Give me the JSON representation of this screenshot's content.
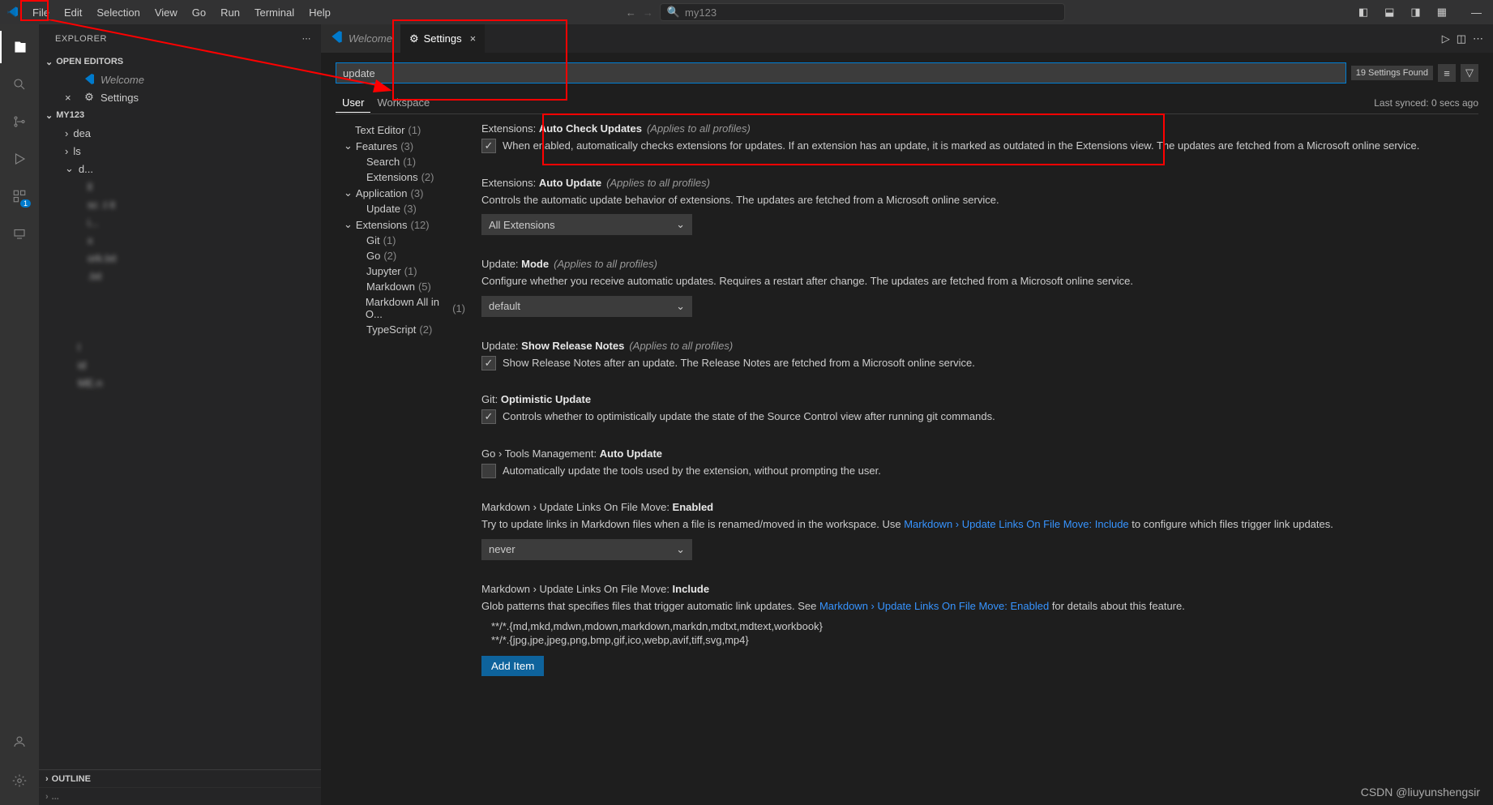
{
  "titlebar": {
    "menu": [
      "File",
      "Edit",
      "Selection",
      "View",
      "Go",
      "Run",
      "Terminal",
      "Help"
    ],
    "search_placeholder": "my123"
  },
  "sidebar": {
    "title": "EXPLORER",
    "open_editors_label": "OPEN EDITORS",
    "open_editors": [
      {
        "label": "Welcome",
        "icon": "vs"
      },
      {
        "label": "Settings",
        "icon": "settings",
        "close": true
      }
    ],
    "project_label": "MY123",
    "tree": [
      {
        "label": "dea",
        "type": "folder",
        "indent": 1
      },
      {
        "label": "ls",
        "type": "folder",
        "indent": 1
      },
      {
        "label": "d...",
        "type": "folder",
        "indent": 1,
        "open": true
      },
      {
        "label": "ll",
        "type": "file",
        "indent": 2,
        "blur": true
      },
      {
        "label": "sc    .t   it",
        "type": "file",
        "indent": 2,
        "blur": true
      },
      {
        "label": "i...",
        "type": "file",
        "indent": 2,
        "blur": true
      },
      {
        "label": "x",
        "type": "file",
        "indent": 2,
        "blur": true
      },
      {
        "label": "ork.txt",
        "type": "file",
        "indent": 2,
        "blur": true
      },
      {
        "label": ".txt",
        "type": "file",
        "indent": 2,
        "blur": true
      },
      {
        "label": "",
        "type": "file",
        "indent": 1,
        "blur": true
      },
      {
        "label": "",
        "type": "file",
        "indent": 1,
        "blur": true
      },
      {
        "label": "",
        "type": "file",
        "indent": 1,
        "blur": true
      },
      {
        "label": "l",
        "type": "file",
        "indent": 1,
        "blur": true
      },
      {
        "label": "id",
        "type": "file",
        "indent": 1,
        "blur": true
      },
      {
        "label": "ME.n",
        "type": "file",
        "indent": 1,
        "blur": true
      }
    ],
    "outline_label": "OUTLINE"
  },
  "tabs": {
    "items": [
      {
        "label": "Welcome",
        "icon": "vs",
        "active": false
      },
      {
        "label": "Settings",
        "icon": "settings",
        "active": true
      }
    ]
  },
  "settings": {
    "search_value": "update",
    "found_text": "19 Settings Found",
    "scope": {
      "user": "User",
      "workspace": "Workspace"
    },
    "sync_text": "Last synced: 0 secs ago",
    "tree": [
      {
        "label": "Text Editor",
        "count": "(1)",
        "level": 0
      },
      {
        "label": "Features",
        "count": "(3)",
        "level": 0,
        "expand": true
      },
      {
        "label": "Search",
        "count": "(1)",
        "level": 1
      },
      {
        "label": "Extensions",
        "count": "(2)",
        "level": 1
      },
      {
        "label": "Application",
        "count": "(3)",
        "level": 0,
        "expand": true
      },
      {
        "label": "Update",
        "count": "(3)",
        "level": 1
      },
      {
        "label": "Extensions",
        "count": "(12)",
        "level": 0,
        "expand": true
      },
      {
        "label": "Git",
        "count": "(1)",
        "level": 1
      },
      {
        "label": "Go",
        "count": "(2)",
        "level": 1
      },
      {
        "label": "Jupyter",
        "count": "(1)",
        "level": 1
      },
      {
        "label": "Markdown",
        "count": "(5)",
        "level": 1
      },
      {
        "label": "Markdown All in O...",
        "count": "(1)",
        "level": 1
      },
      {
        "label": "TypeScript",
        "count": "(2)",
        "level": 1
      }
    ],
    "items": [
      {
        "prefix": "Extensions:",
        "name": "Auto Check Updates",
        "scope": "(Applies to all profiles)",
        "type": "checkbox",
        "checked": true,
        "desc": "When enabled, automatically checks extensions for updates. If an extension has an update, it is marked as outdated in the Extensions view. The updates are fetched from a Microsoft online service."
      },
      {
        "prefix": "Extensions:",
        "name": "Auto Update",
        "scope": "(Applies to all profiles)",
        "type": "select",
        "value": "All Extensions",
        "desc": "Controls the automatic update behavior of extensions. The updates are fetched from a Microsoft online service."
      },
      {
        "prefix": "Update:",
        "name": "Mode",
        "scope": "(Applies to all profiles)",
        "type": "select",
        "value": "default",
        "desc": "Configure whether you receive automatic updates. Requires a restart after change. The updates are fetched from a Microsoft online service."
      },
      {
        "prefix": "Update:",
        "name": "Show Release Notes",
        "scope": "(Applies to all profiles)",
        "type": "checkbox",
        "checked": true,
        "desc": "Show Release Notes after an update. The Release Notes are fetched from a Microsoft online service."
      },
      {
        "prefix": "Git:",
        "name": "Optimistic Update",
        "scope": "",
        "type": "checkbox",
        "checked": true,
        "desc": "Controls whether to optimistically update the state of the Source Control view after running git commands."
      },
      {
        "prefix": "Go › Tools Management:",
        "name": "Auto Update",
        "scope": "",
        "type": "checkbox",
        "checked": false,
        "desc": "Automatically update the tools used by the extension, without prompting the user."
      },
      {
        "prefix": "Markdown › Update Links On File Move:",
        "name": "Enabled",
        "scope": "",
        "type": "select",
        "value": "never",
        "desc": "Try to update links in Markdown files when a file is renamed/moved in the workspace. Use ",
        "link": "Markdown › Update Links On File Move: Include",
        "desc2": " to configure which files trigger link updates."
      },
      {
        "prefix": "Markdown › Update Links On File Move:",
        "name": "Include",
        "scope": "",
        "type": "list",
        "desc": "Glob patterns that specifies files that trigger automatic link updates. See ",
        "link": "Markdown › Update Links On File Move: Enabled",
        "desc2": " for details about this feature.",
        "list_items": [
          "**/*.{md,mkd,mdwn,mdown,markdown,markdn,mdtxt,mdtext,workbook}",
          "**/*.{jpg,jpe,jpeg,png,bmp,gif,ico,webp,avif,tiff,svg,mp4}"
        ],
        "add_label": "Add Item"
      }
    ]
  },
  "watermark": "CSDN @liuyunshengsir"
}
